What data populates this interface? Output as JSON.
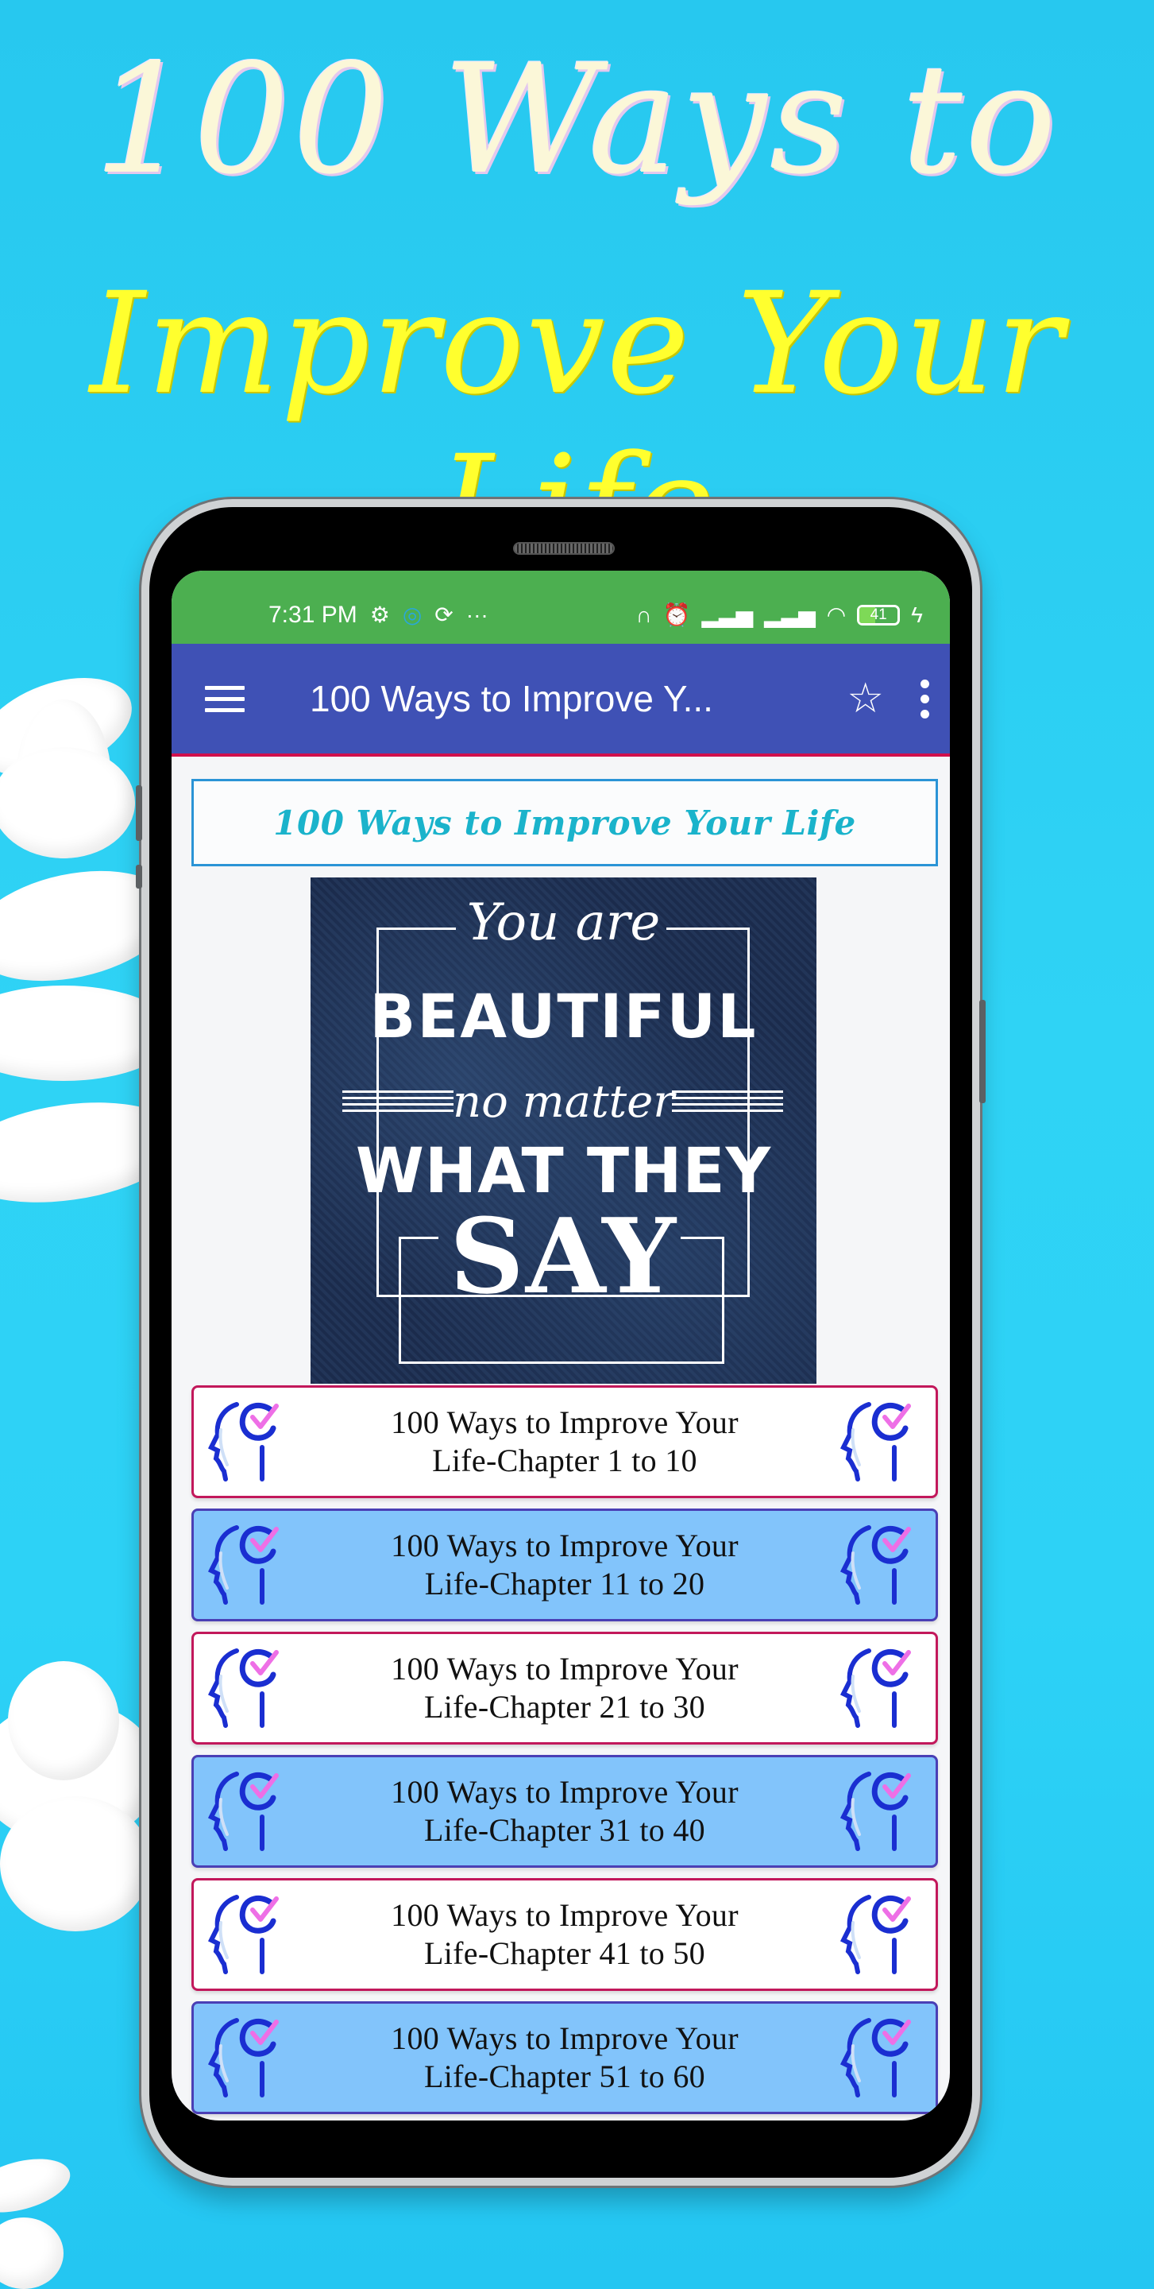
{
  "promo": {
    "headline_line1": "100 Ways to",
    "headline_line2": "Improve Your Life"
  },
  "status_bar": {
    "time": "7:31 PM",
    "left_icons": [
      "gear-icon",
      "messenger-icon",
      "share-icon",
      "more-notifications-icon"
    ],
    "right_icons": [
      "headphones-icon",
      "alarm-icon",
      "signal-icon",
      "signal-icon",
      "wifi-icon"
    ],
    "battery_level": "41",
    "battery_fraction": 0.41,
    "charging": true
  },
  "app_bar": {
    "title": "100 Ways to Improve Y...",
    "menu_icon": "hamburger-menu-icon",
    "favorite_icon": "star-outline-icon",
    "overflow_icon": "more-vert-icon"
  },
  "content": {
    "title_box": "100 Ways to Improve Your Life",
    "quote_image": {
      "line1": "You are",
      "line2": "BEAUTIFUL",
      "line3": "no matter",
      "line4": "WHAT THEY",
      "line5": "SAY"
    },
    "chapters": [
      {
        "line1": "100 Ways to Improve Your",
        "line2": "Life-Chapter 1 to 10",
        "style": "white"
      },
      {
        "line1": "100 Ways to Improve Your",
        "line2": "Life-Chapter 11 to 20",
        "style": "blue"
      },
      {
        "line1": "100 Ways to Improve Your",
        "line2": "Life-Chapter 21 to 30",
        "style": "white"
      },
      {
        "line1": "100 Ways to Improve Your",
        "line2": "Life-Chapter 31 to 40",
        "style": "blue"
      },
      {
        "line1": "100 Ways to Improve Your",
        "line2": "Life-Chapter 41 to 50",
        "style": "white"
      },
      {
        "line1": "100 Ways to Improve Your",
        "line2": "Life-Chapter 51 to 60",
        "style": "blue"
      }
    ]
  },
  "colors": {
    "background": "#2bcdf3",
    "status_bar": "#4caf50",
    "app_bar": "#3f51b5",
    "accent_line": "#d0104c",
    "title_text": "#1ab3cb",
    "chapter_blue": "#82c4fb",
    "chapter_white_border": "#c2185b",
    "chapter_blue_border": "#4a3fb5",
    "icon_blue": "#1a2ed1",
    "icon_pink": "#ee6fe6"
  }
}
